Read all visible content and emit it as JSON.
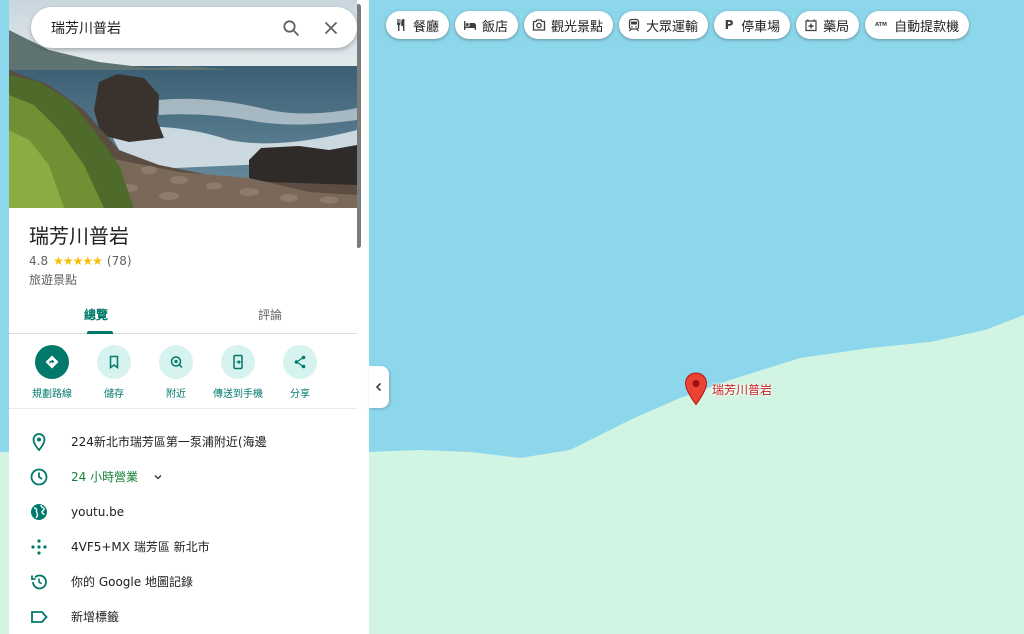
{
  "search": {
    "query": "瑞芳川普岩"
  },
  "place": {
    "name": "瑞芳川普岩",
    "rating": "4.8",
    "stars": "★★★★★",
    "reviews": "(78)",
    "category": "旅遊景點"
  },
  "tabs": [
    {
      "label": "總覽",
      "active": true
    },
    {
      "label": "評論",
      "active": false
    }
  ],
  "actions": [
    {
      "label": "規劃路線",
      "icon": "directions-icon"
    },
    {
      "label": "儲存",
      "icon": "bookmark-icon"
    },
    {
      "label": "附近",
      "icon": "nearby-icon"
    },
    {
      "label": "傳送到手機",
      "icon": "send-to-phone-icon"
    },
    {
      "label": "分享",
      "icon": "share-icon"
    }
  ],
  "info": {
    "address": "224新北市瑞芳區第一泵浦附近(海邊",
    "hours": "24 小時營業",
    "website": "youtu.be",
    "plus_code": "4VF5+MX 瑞芳區 新北市",
    "history": "你的 Google 地圖記錄",
    "label": "新增標籤"
  },
  "chips": [
    {
      "label": "餐廳",
      "icon": "restaurant-icon"
    },
    {
      "label": "飯店",
      "icon": "hotel-icon"
    },
    {
      "label": "觀光景點",
      "icon": "camera-icon"
    },
    {
      "label": "大眾運輸",
      "icon": "transit-icon"
    },
    {
      "label": "停車場",
      "icon": "parking-icon",
      "glyph": "P"
    },
    {
      "label": "藥局",
      "icon": "pharmacy-icon"
    },
    {
      "label": "自動提款機",
      "icon": "atm-icon",
      "glyph": "ATM"
    }
  ],
  "map": {
    "pin_label": "瑞芳川普岩",
    "water_color": "#8dd7ec",
    "land_color": "#d2f5e3"
  },
  "colors": {
    "accent": "#00796b",
    "open": "#188038",
    "pin": "#ea4335"
  }
}
